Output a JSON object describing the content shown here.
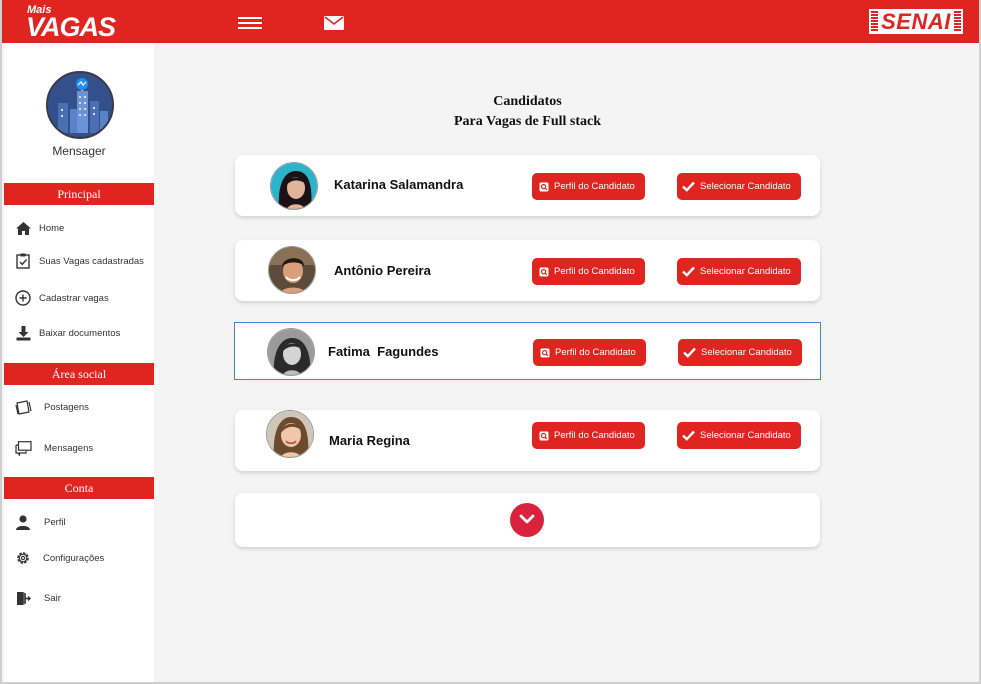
{
  "header": {
    "logo_small": "Mais",
    "logo_big": "VAGAS",
    "brand": "SENAI"
  },
  "sidebar": {
    "profile_name": "Mensager",
    "sections": [
      {
        "title": "Principal"
      },
      {
        "title": "Área social"
      },
      {
        "title": "Conta"
      }
    ],
    "items": [
      {
        "label": "Home",
        "icon": "home-icon"
      },
      {
        "label": "Suas Vagas cadastradas",
        "icon": "clipboard-check-icon"
      },
      {
        "label": "Cadastrar vagas",
        "icon": "plus-circle-icon"
      },
      {
        "label": "Baixar documentos",
        "icon": "download-icon"
      },
      {
        "label": "Postagens",
        "icon": "posts-icon"
      },
      {
        "label": "Mensagens",
        "icon": "chat-icon"
      },
      {
        "label": "Perfil",
        "icon": "user-icon"
      },
      {
        "label": "Configurações",
        "icon": "gear-icon"
      },
      {
        "label": "Sair",
        "icon": "exit-icon"
      }
    ]
  },
  "main": {
    "title_line1": "Candidatos",
    "title_line2": "Para Vagas de Full stack",
    "candidates": [
      {
        "name": "Katarina Salamandra",
        "profile_label": "Perfil do Candidato",
        "select_label": "Selecionar Candidato"
      },
      {
        "name": "Antônio Pereira",
        "profile_label": "Perfil do Candidato",
        "select_label": "Selecionar Candidato"
      },
      {
        "name": "Fatima  Fagundes",
        "profile_label": "Perfil do Candidato",
        "select_label": "Selecionar Candidato"
      },
      {
        "name": "Maria Regina",
        "profile_label": "Perfil do Candidato",
        "select_label": "Selecionar Candidato"
      }
    ]
  },
  "colors": {
    "brand_red": "#e0241f",
    "more_button": "#d9233e",
    "selected_border": "#3f88d0"
  }
}
